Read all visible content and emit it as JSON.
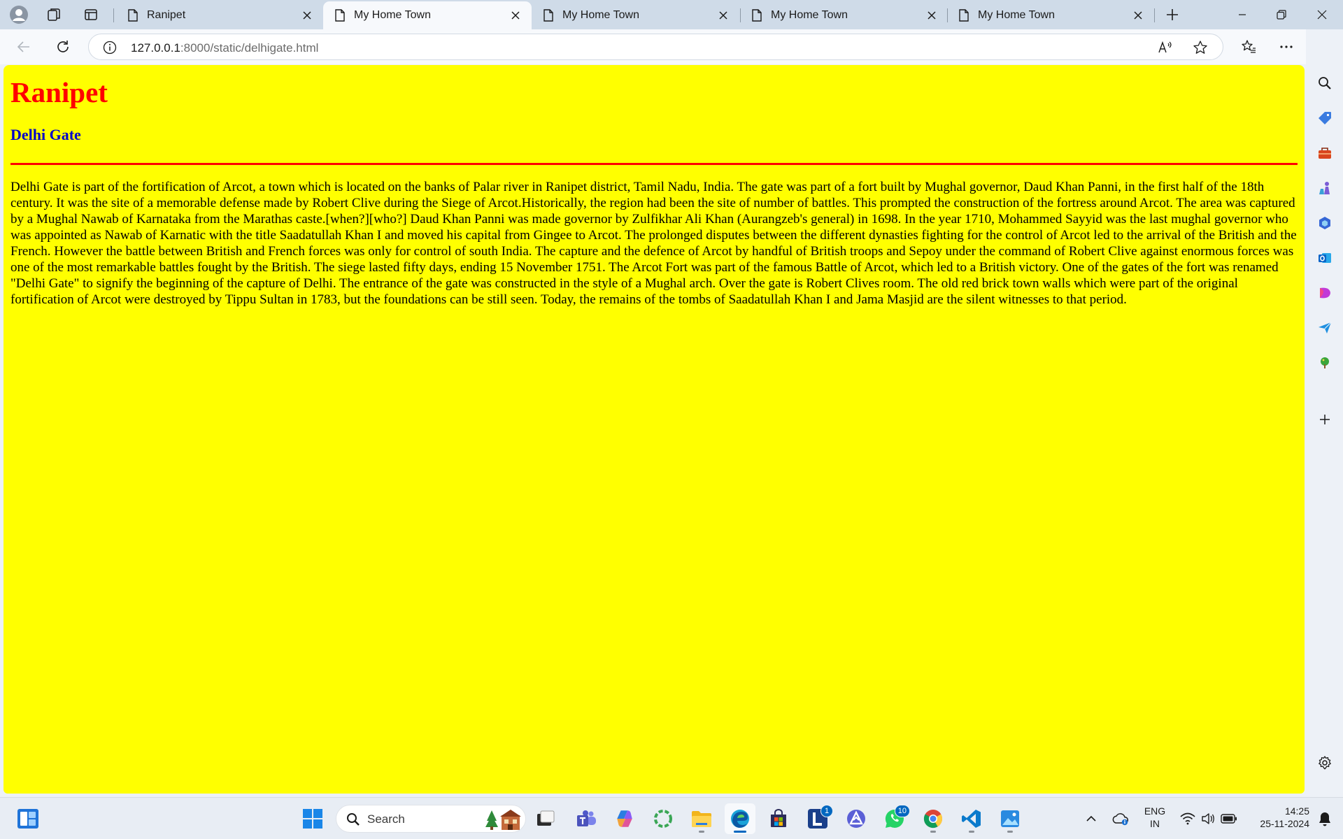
{
  "browser": {
    "tabs": [
      {
        "title": "Ranipet",
        "active": false
      },
      {
        "title": "My Home Town",
        "active": true
      },
      {
        "title": "My Home Town",
        "active": false
      },
      {
        "title": "My Home Town",
        "active": false
      },
      {
        "title": "My Home Town",
        "active": false
      }
    ],
    "address": {
      "host": "127.0.0.1",
      "path": ":8000/static/delhigate.html"
    }
  },
  "page": {
    "heading": "Ranipet",
    "subheading": "Delhi Gate",
    "body": "Delhi Gate is part of the fortification of Arcot, a town which is located on the banks of Palar river in Ranipet district, Tamil Nadu, India. The gate was part of a fort built by Mughal governor, Daud Khan Panni, in the first half of the 18th century. It was the site of a memorable defense made by Robert Clive during the Siege of Arcot.Historically, the region had been the site of number of battles. This prompted the construction of the fortress around Arcot. The area was captured by a Mughal Nawab of Karnataka from the Marathas caste.[when?][who?] Daud Khan Panni was made governor by Zulfikhar Ali Khan (Aurangzeb's general) in 1698. In the year 1710, Mohammed Sayyid was the last mughal governor who was appointed as Nawab of Karnatic with the title Saadatullah Khan I and moved his capital from Gingee to Arcot. The prolonged disputes between the different dynasties fighting for the control of Arcot led to the arrival of the British and the French. However the battle between British and French forces was only for control of south India. The capture and the defence of Arcot by handful of British troops and Sepoy under the command of Robert Clive against enormous forces was one of the most remarkable battles fought by the British. The siege lasted fifty days, ending 15 November 1751. The Arcot Fort was part of the famous Battle of Arcot, which led to a British victory. One of the gates of the fort was renamed \"Delhi Gate\" to signify the beginning of the capture of Delhi. The entrance of the gate was constructed in the style of a Mughal arch. Over the gate is Robert Clives room. The old red brick town walls which were part of the original fortification of Arcot were destroyed by Tippu Sultan in 1783, but the foundations can be still seen. Today, the remains of the tombs of Saadatullah Khan I and Jama Masjid are the silent witnesses to that period.",
    "colors": {
      "background": "#ffff00",
      "heading": "#ff0000",
      "subheading": "#0000cc",
      "rule": "#ff0000"
    }
  },
  "taskbar": {
    "search_label": "Search",
    "badges": {
      "lens": "1",
      "whatsapp": "10"
    },
    "tray": {
      "lang_line1": "ENG",
      "lang_line2": "IN",
      "time": "14:25",
      "date": "25-11-2024"
    }
  }
}
